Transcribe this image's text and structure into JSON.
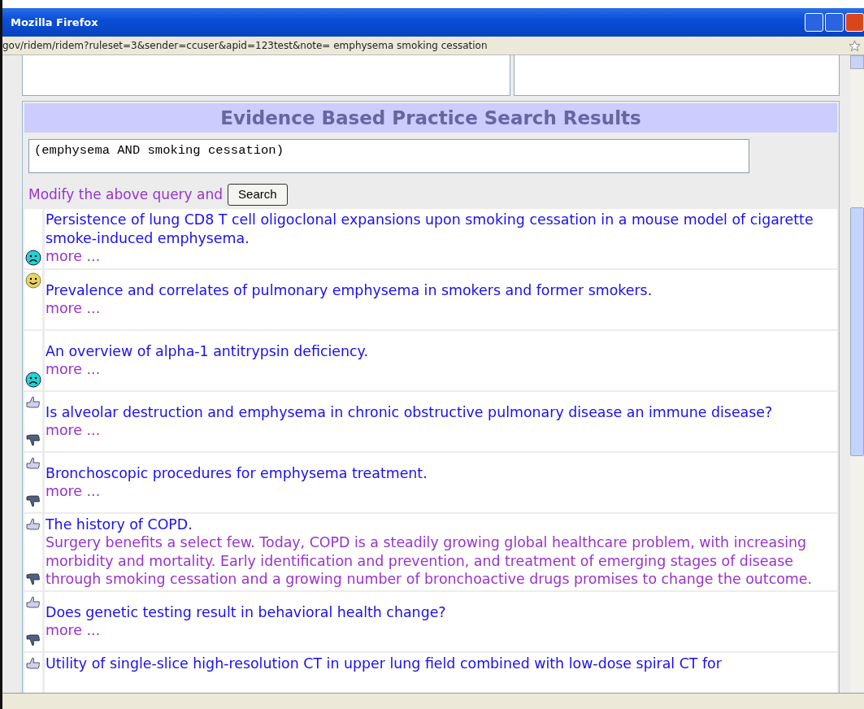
{
  "window": {
    "title": "Mozilla Firefox"
  },
  "address_bar": {
    "url": "gov/ridem/ridem?ruleset=3&sender=ccuser&apid=123test&note= emphysema smoking cessation"
  },
  "panel": {
    "title": "Evidence Based Practice Search Results",
    "query": "(emphysema AND smoking cessation)",
    "prompt": "Modify the above query and",
    "search_button": "Search"
  },
  "results": [
    {
      "title": "Persistence of lung CD8 T cell oligoclonal expansions upon smoking cessation in a mouse model of cigarette smoke-induced emphysema.",
      "more": "more ...",
      "icons": {
        "bottom": {
          "kind": "sad"
        }
      }
    },
    {
      "title": "Prevalence and correlates of pulmonary emphysema in smokers and former smokers.",
      "more": "more ...",
      "icons": {
        "top": {
          "kind": "smile"
        }
      }
    },
    {
      "title": "An overview of alpha-1 antitrypsin deficiency.",
      "more": "more ...",
      "icons": {
        "bottom": {
          "kind": "sad"
        }
      }
    },
    {
      "title": "Is alveolar destruction and emphysema in chronic obstructive pulmonary disease an immune disease?",
      "more": "more ...",
      "icons": {
        "top": {
          "kind": "thumbs_up"
        },
        "bottom": {
          "kind": "thumbs_down"
        }
      }
    },
    {
      "title": "Bronchoscopic procedures for emphysema treatment.",
      "more": "more ...",
      "icons": {
        "top": {
          "kind": "thumbs_up"
        },
        "bottom": {
          "kind": "thumbs_down"
        }
      }
    },
    {
      "title": "The history of COPD.",
      "summary": "Surgery benefits a select few. Today, COPD is a steadily growing global healthcare problem, with increasing morbidity and mortality. Early identification and prevention, and treatment of emerging stages of disease through smoking cessation and a growing number of bronchoactive drugs promises to change the outcome.",
      "icons": {
        "top": {
          "kind": "thumbs_up"
        },
        "bottom": {
          "kind": "thumbs_down"
        }
      }
    },
    {
      "title": "Does genetic testing result in behavioral health change?",
      "more": "more ...",
      "icons": {
        "top": {
          "kind": "thumbs_up"
        },
        "bottom": {
          "kind": "thumbs_down"
        }
      }
    },
    {
      "title": "Utility of single-slice high-resolution CT in upper lung field combined with low-dose spiral CT for",
      "icons": {
        "top": {
          "kind": "thumbs_up"
        }
      }
    }
  ]
}
